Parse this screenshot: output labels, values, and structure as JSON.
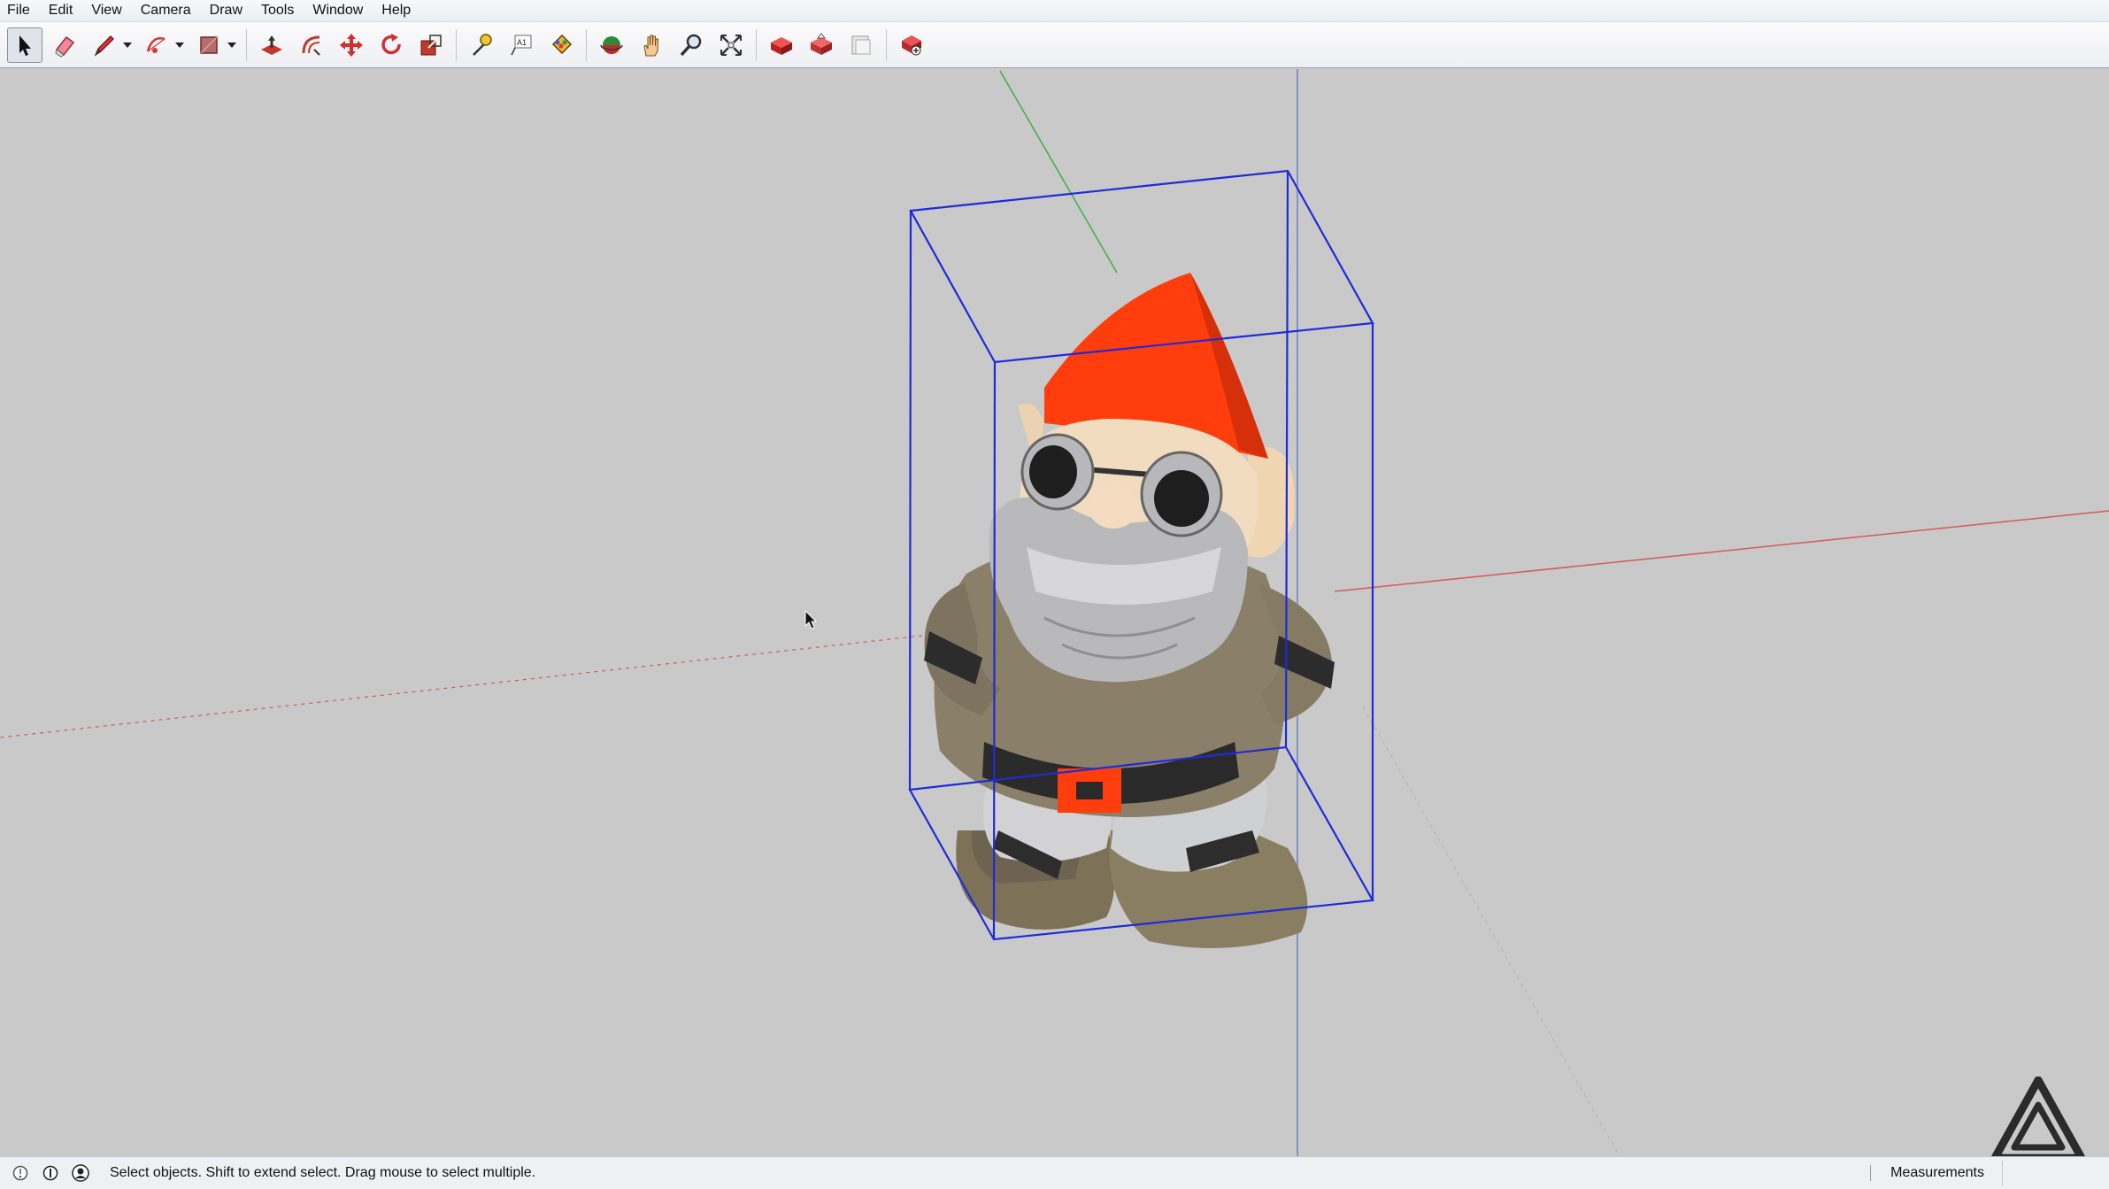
{
  "menu": {
    "items": [
      "File",
      "Edit",
      "View",
      "Camera",
      "Draw",
      "Tools",
      "Window",
      "Help"
    ]
  },
  "toolbar": {
    "tools": [
      {
        "name": "select-tool",
        "icon": "arrow-cursor-icon",
        "selected": true
      },
      {
        "name": "eraser-tool",
        "icon": "eraser-icon"
      },
      {
        "name": "line-tool",
        "icon": "pencil-icon"
      },
      {
        "name": "arc-tool",
        "icon": "arc-icon"
      },
      {
        "name": "shape-tool",
        "icon": "rectangle-icon"
      },
      {
        "name": "push-pull-tool",
        "icon": "push-pull-icon"
      },
      {
        "name": "offset-tool",
        "icon": "offset-icon"
      },
      {
        "name": "move-tool",
        "icon": "move-icon"
      },
      {
        "name": "rotate-tool",
        "icon": "rotate-icon"
      },
      {
        "name": "scale-tool",
        "icon": "scale-icon"
      },
      {
        "name": "tape-measure-tool",
        "icon": "tape-measure-icon"
      },
      {
        "name": "text-tool",
        "icon": "text-icon"
      },
      {
        "name": "paint-bucket-tool",
        "icon": "paint-bucket-icon"
      },
      {
        "name": "orbit-tool",
        "icon": "orbit-icon"
      },
      {
        "name": "pan-tool",
        "icon": "hand-icon"
      },
      {
        "name": "zoom-tool",
        "icon": "magnifier-icon"
      },
      {
        "name": "zoom-extents-tool",
        "icon": "zoom-extents-icon"
      },
      {
        "name": "warehouse-tool",
        "icon": "warehouse-icon"
      },
      {
        "name": "share-model-tool",
        "icon": "share-model-icon"
      },
      {
        "name": "layout-tool",
        "icon": "layout-icon"
      },
      {
        "name": "extension-warehouse-tool",
        "icon": "extension-warehouse-icon"
      }
    ]
  },
  "status": {
    "text": "Select objects. Shift to extend select. Drag mouse to select multiple.",
    "measurements_label": "Measurements",
    "icons": [
      "geolocation-icon",
      "credits-icon",
      "user-account-icon"
    ]
  },
  "colors": {
    "viewport": "#c9c9c9",
    "selection_box": "#1f2bd8",
    "red_axis": "#d45a5a",
    "green_axis": "#3fae4a",
    "blue_axis": "#6f80c8",
    "gnome_hat": "#ff3d0d",
    "gnome_body": "#8a7f68",
    "gnome_beard": "#b9b9bb"
  }
}
